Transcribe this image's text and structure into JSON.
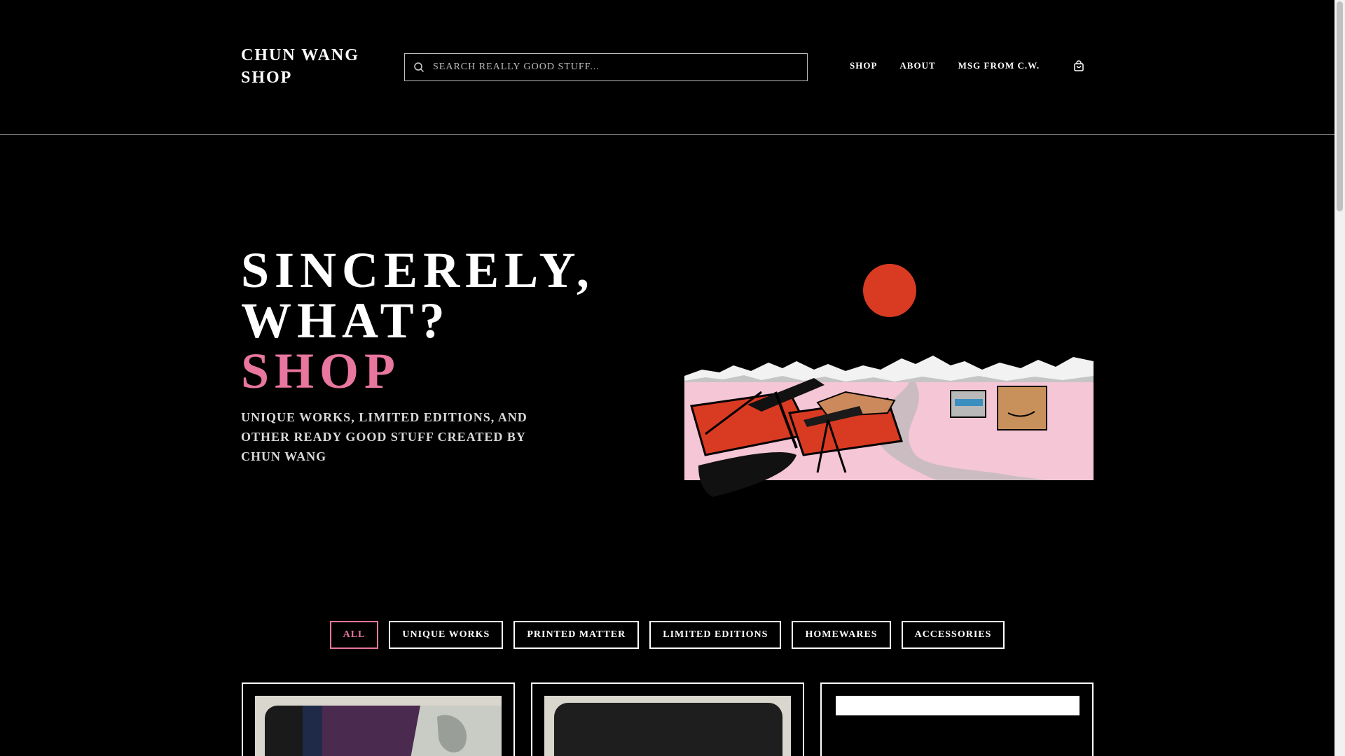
{
  "header": {
    "logo": "CHUN WANG\nSHOP",
    "search_placeholder": "SEARCH REALLY GOOD STUFF...",
    "nav": [
      "SHOP",
      "ABOUT",
      "MSG FROM C.W."
    ],
    "cart_icon": "shopping-bag-icon"
  },
  "hero": {
    "title_line1": "SINCERELY,",
    "title_line2": "WHAT?",
    "title_line3": "SHOP",
    "subtitle": "UNIQUE WORKS, LIMITED EDITIONS, AND OTHER READY GOOD STUFF CREATED BY CHUN WANG",
    "art_icon": "desert-landscape-illustration"
  },
  "filters": [
    "ALL",
    "UNIQUE WORKS",
    "PRINTED MATTER",
    "LIMITED EDITIONS",
    "HOMEWARES",
    "ACCESSORIES"
  ],
  "colors": {
    "accent": "#e8769f",
    "sun": "#d93a22",
    "ground": "#f5c6d6"
  }
}
